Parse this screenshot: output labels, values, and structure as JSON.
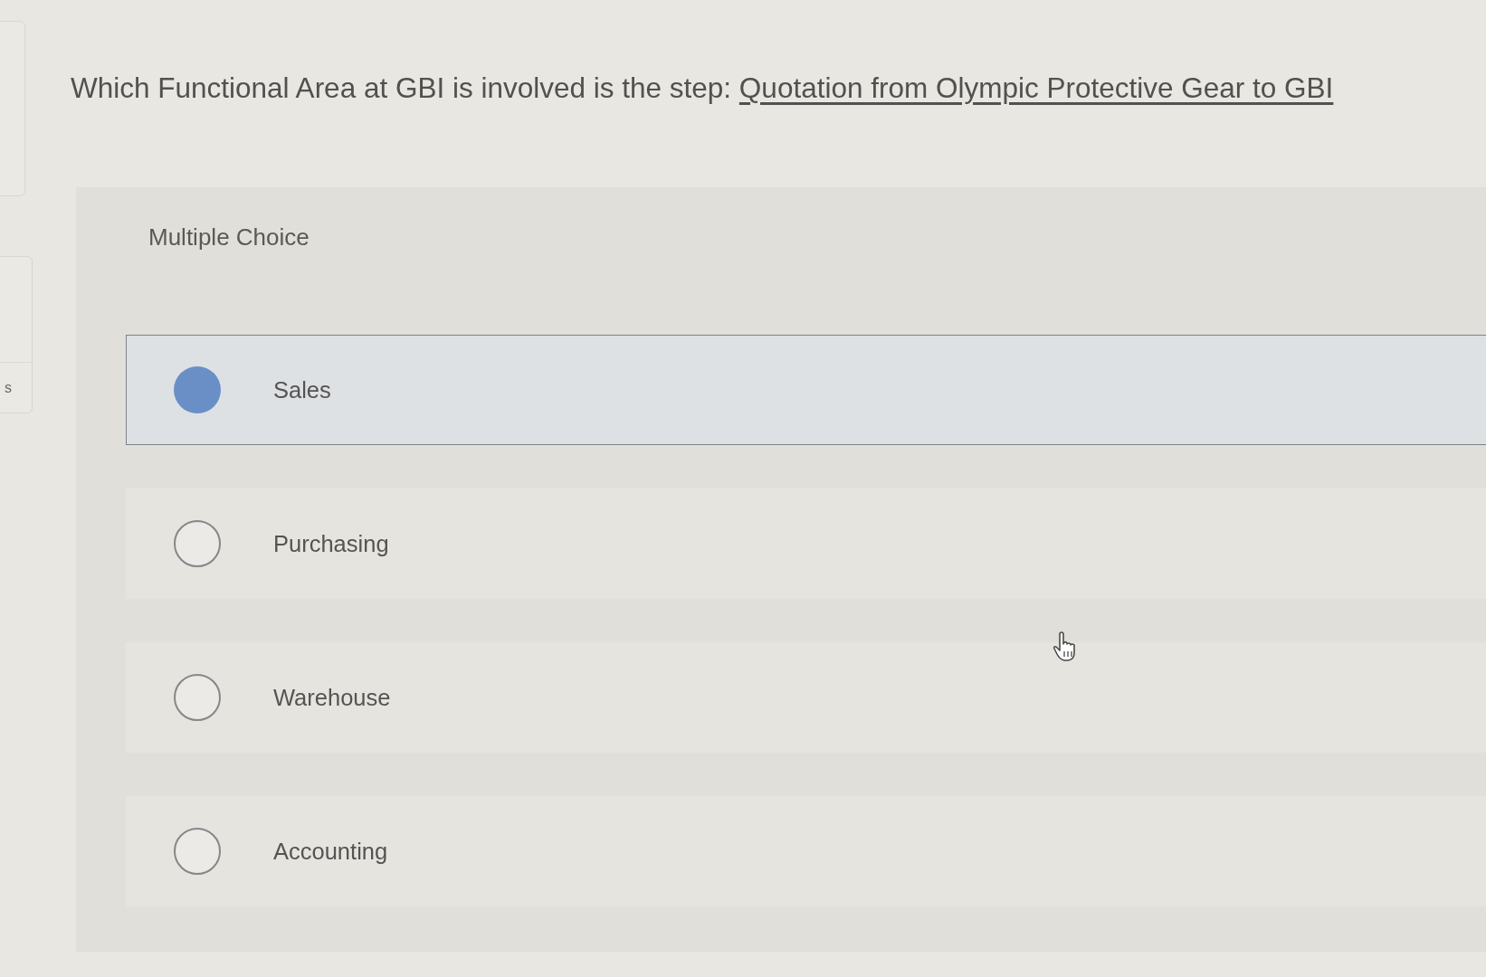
{
  "sidebar": {
    "items": [
      {
        "label": "s"
      }
    ]
  },
  "question": {
    "prompt": "Which Functional Area at GBI is involved is the step: ",
    "link": "Quotation from Olympic Protective Gear to GBI"
  },
  "answer_panel": {
    "type_label": "Multiple Choice",
    "options": [
      {
        "label": "Sales",
        "selected": true
      },
      {
        "label": "Purchasing",
        "selected": false
      },
      {
        "label": "Warehouse",
        "selected": false
      },
      {
        "label": "Accounting",
        "selected": false
      }
    ]
  }
}
